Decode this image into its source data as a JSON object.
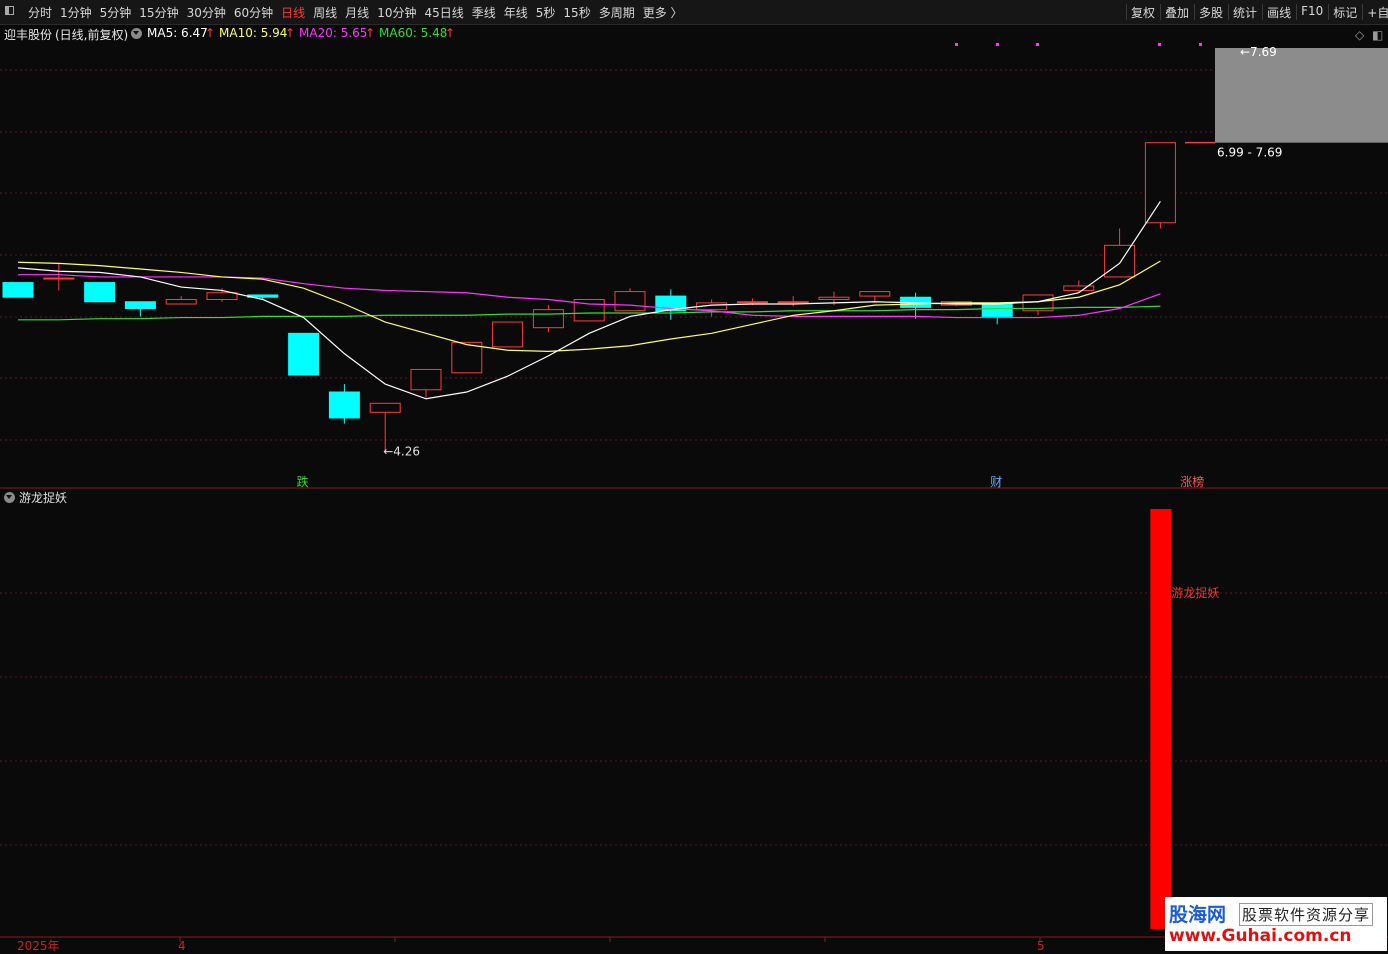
{
  "toolbar": {
    "periods": [
      "分时",
      "1分钟",
      "5分钟",
      "15分钟",
      "30分钟",
      "60分钟",
      "日线",
      "周线",
      "月线",
      "10分钟",
      "45日线",
      "季线",
      "年线",
      "5秒",
      "15秒",
      "多周期",
      "更多 〉"
    ],
    "active_period": "日线",
    "right_items": [
      "复权",
      "叠加",
      "多股",
      "统计",
      "画线",
      "F10",
      "标记",
      "+自"
    ]
  },
  "info": {
    "stock_name": "迎丰股份",
    "mode": "(日线,前复权)",
    "ma5": "MA5: 6.47",
    "ma10": "MA10: 5.94",
    "ma20": "MA20: 5.65",
    "ma60": "MA60: 5.48",
    "arrow": "↑"
  },
  "colors": {
    "up": "#ff3b3b",
    "down": "#00ffff",
    "ma5": "#ffffff",
    "ma10": "#ffff66",
    "ma20": "#ff33ff",
    "ma60": "#33dd33",
    "signal_bar": "#ff0000"
  },
  "chart_data": {
    "type": "candlestick",
    "ylim": [
      4.0,
      7.9
    ],
    "candles": [
      {
        "o": 5.75,
        "h": 5.75,
        "l": 5.62,
        "c": 5.62
      },
      {
        "o": 5.79,
        "h": 5.92,
        "l": 5.68,
        "c": 5.79
      },
      {
        "o": 5.75,
        "h": 5.75,
        "l": 5.58,
        "c": 5.58
      },
      {
        "o": 5.58,
        "h": 5.58,
        "l": 5.45,
        "c": 5.52
      },
      {
        "o": 5.56,
        "h": 5.63,
        "l": 5.56,
        "c": 5.6
      },
      {
        "o": 5.6,
        "h": 5.7,
        "l": 5.58,
        "c": 5.66
      },
      {
        "o": 5.64,
        "h": 5.64,
        "l": 5.6,
        "c": 5.62
      },
      {
        "o": 5.3,
        "h": 5.3,
        "l": 4.93,
        "c": 4.93
      },
      {
        "o": 4.78,
        "h": 4.85,
        "l": 4.5,
        "c": 4.55
      },
      {
        "o": 4.6,
        "h": 4.68,
        "l": 4.26,
        "c": 4.68
      },
      {
        "o": 4.8,
        "h": 4.98,
        "l": 4.73,
        "c": 4.98
      },
      {
        "o": 4.95,
        "h": 5.22,
        "l": 4.95,
        "c": 5.22
      },
      {
        "o": 5.18,
        "h": 5.4,
        "l": 5.18,
        "c": 5.4
      },
      {
        "o": 5.35,
        "h": 5.55,
        "l": 5.31,
        "c": 5.51
      },
      {
        "o": 5.41,
        "h": 5.6,
        "l": 5.41,
        "c": 5.6
      },
      {
        "o": 5.5,
        "h": 5.7,
        "l": 5.5,
        "c": 5.67
      },
      {
        "o": 5.63,
        "h": 5.69,
        "l": 5.42,
        "c": 5.5
      },
      {
        "o": 5.51,
        "h": 5.6,
        "l": 5.45,
        "c": 5.57
      },
      {
        "o": 5.58,
        "h": 5.61,
        "l": 5.55,
        "c": 5.58
      },
      {
        "o": 5.58,
        "h": 5.63,
        "l": 5.54,
        "c": 5.58
      },
      {
        "o": 5.6,
        "h": 5.67,
        "l": 5.55,
        "c": 5.62
      },
      {
        "o": 5.63,
        "h": 5.65,
        "l": 5.57,
        "c": 5.67
      },
      {
        "o": 5.62,
        "h": 5.66,
        "l": 5.43,
        "c": 5.53
      },
      {
        "o": 5.55,
        "h": 5.58,
        "l": 5.54,
        "c": 5.58
      },
      {
        "o": 5.56,
        "h": 5.56,
        "l": 5.38,
        "c": 5.45
      },
      {
        "o": 5.5,
        "h": 5.64,
        "l": 5.46,
        "c": 5.64
      },
      {
        "o": 5.68,
        "h": 5.77,
        "l": 5.66,
        "c": 5.72
      },
      {
        "o": 5.8,
        "h": 6.23,
        "l": 5.8,
        "c": 6.08
      },
      {
        "o": 6.28,
        "h": 6.99,
        "l": 6.23,
        "c": 6.99
      }
    ],
    "ma5": [
      5.88,
      5.85,
      5.84,
      5.8,
      5.71,
      5.68,
      5.6,
      5.44,
      5.12,
      4.85,
      4.72,
      4.78,
      4.92,
      5.1,
      5.3,
      5.45,
      5.51,
      5.55,
      5.56,
      5.56,
      5.57,
      5.58,
      5.57,
      5.56,
      5.56,
      5.58,
      5.66,
      5.92,
      6.47
    ],
    "ma10": [
      5.93,
      5.92,
      5.9,
      5.87,
      5.84,
      5.8,
      5.78,
      5.7,
      5.56,
      5.4,
      5.3,
      5.2,
      5.15,
      5.14,
      5.16,
      5.19,
      5.25,
      5.3,
      5.38,
      5.46,
      5.5,
      5.55,
      5.56,
      5.57,
      5.57,
      5.58,
      5.62,
      5.73,
      5.94
    ],
    "ma20": [
      5.82,
      5.82,
      5.8,
      5.8,
      5.8,
      5.8,
      5.79,
      5.74,
      5.7,
      5.68,
      5.67,
      5.66,
      5.62,
      5.6,
      5.56,
      5.55,
      5.52,
      5.5,
      5.46,
      5.45,
      5.45,
      5.45,
      5.45,
      5.44,
      5.44,
      5.44,
      5.46,
      5.52,
      5.65
    ],
    "ma60": [
      5.42,
      5.42,
      5.43,
      5.43,
      5.44,
      5.44,
      5.45,
      5.45,
      5.45,
      5.46,
      5.46,
      5.46,
      5.47,
      5.47,
      5.48,
      5.48,
      5.48,
      5.49,
      5.49,
      5.5,
      5.5,
      5.5,
      5.51,
      5.51,
      5.52,
      5.52,
      5.53,
      5.53,
      5.54
    ],
    "low_label": "4.26",
    "high_label": "7.69",
    "range_label": "6.99 - 7.69",
    "event_markers": [
      {
        "index": 7,
        "text": "跌",
        "color": "#33dd33"
      },
      {
        "index": 24,
        "text": "财",
        "color": "#66aaff"
      },
      {
        "index": 29,
        "text": "涨榜",
        "color": "#ff5555"
      }
    ],
    "x_labels": [
      {
        "index": 0,
        "text": "2025年"
      },
      {
        "index": 4,
        "text": "4"
      },
      {
        "index": 25,
        "text": "5"
      }
    ],
    "indicator": {
      "title": "游龙捉妖",
      "signal_index": 28,
      "signal_label": "游龙捉妖"
    }
  },
  "watermark": {
    "line1": "股海网",
    "line2": "股票软件资源分享",
    "line3": "www.Guhai.com.cn"
  }
}
